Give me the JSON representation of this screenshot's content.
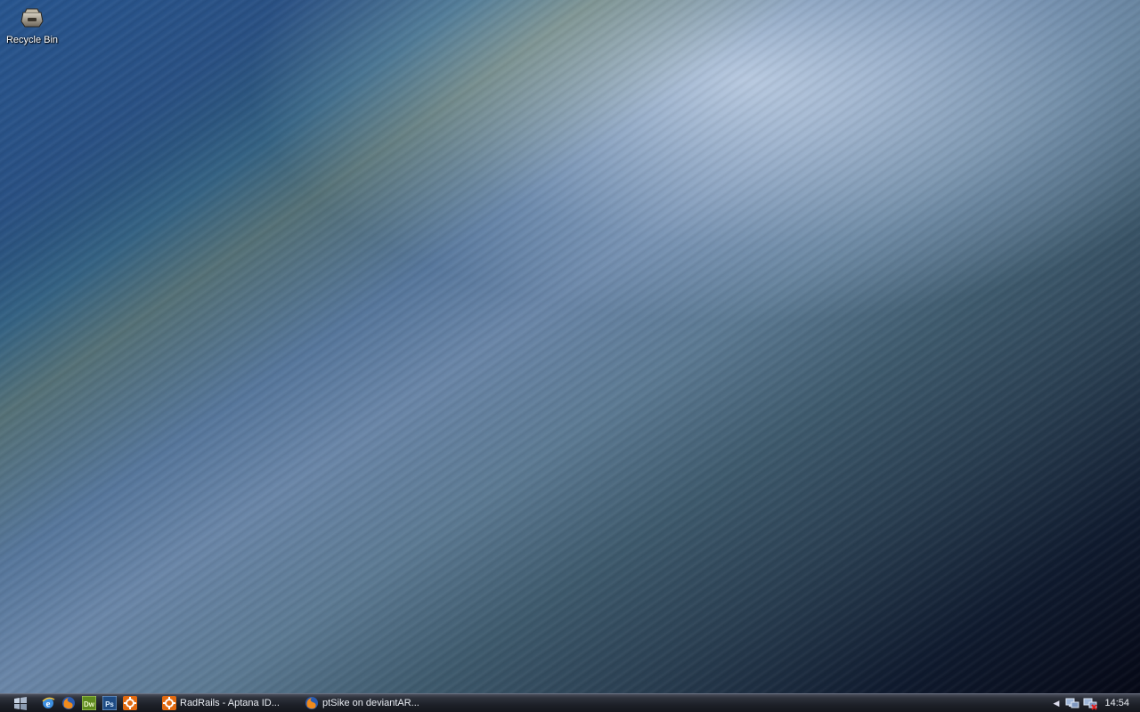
{
  "desktop": {
    "icons": [
      {
        "label": "Recycle Bin",
        "icon": "recycle-bin-icon"
      }
    ]
  },
  "taskbar": {
    "start_icon": "windows-logo-icon",
    "quick_launch": [
      {
        "icon": "internet-explorer-icon"
      },
      {
        "icon": "firefox-icon"
      },
      {
        "icon": "dreamweaver-icon",
        "text": "Dw"
      },
      {
        "icon": "photoshop-icon",
        "text": "Ps"
      },
      {
        "icon": "aptana-icon"
      }
    ],
    "tasks": [
      {
        "label": "RadRails - Aptana ID...",
        "icon": "aptana-icon"
      },
      {
        "label": "ptSike on deviantAR...",
        "icon": "firefox-icon"
      }
    ],
    "tray": {
      "expand_icon": "chevron-left-icon",
      "icons": [
        "network-icon",
        "network-disconnected-icon"
      ],
      "clock": "14:54"
    }
  }
}
